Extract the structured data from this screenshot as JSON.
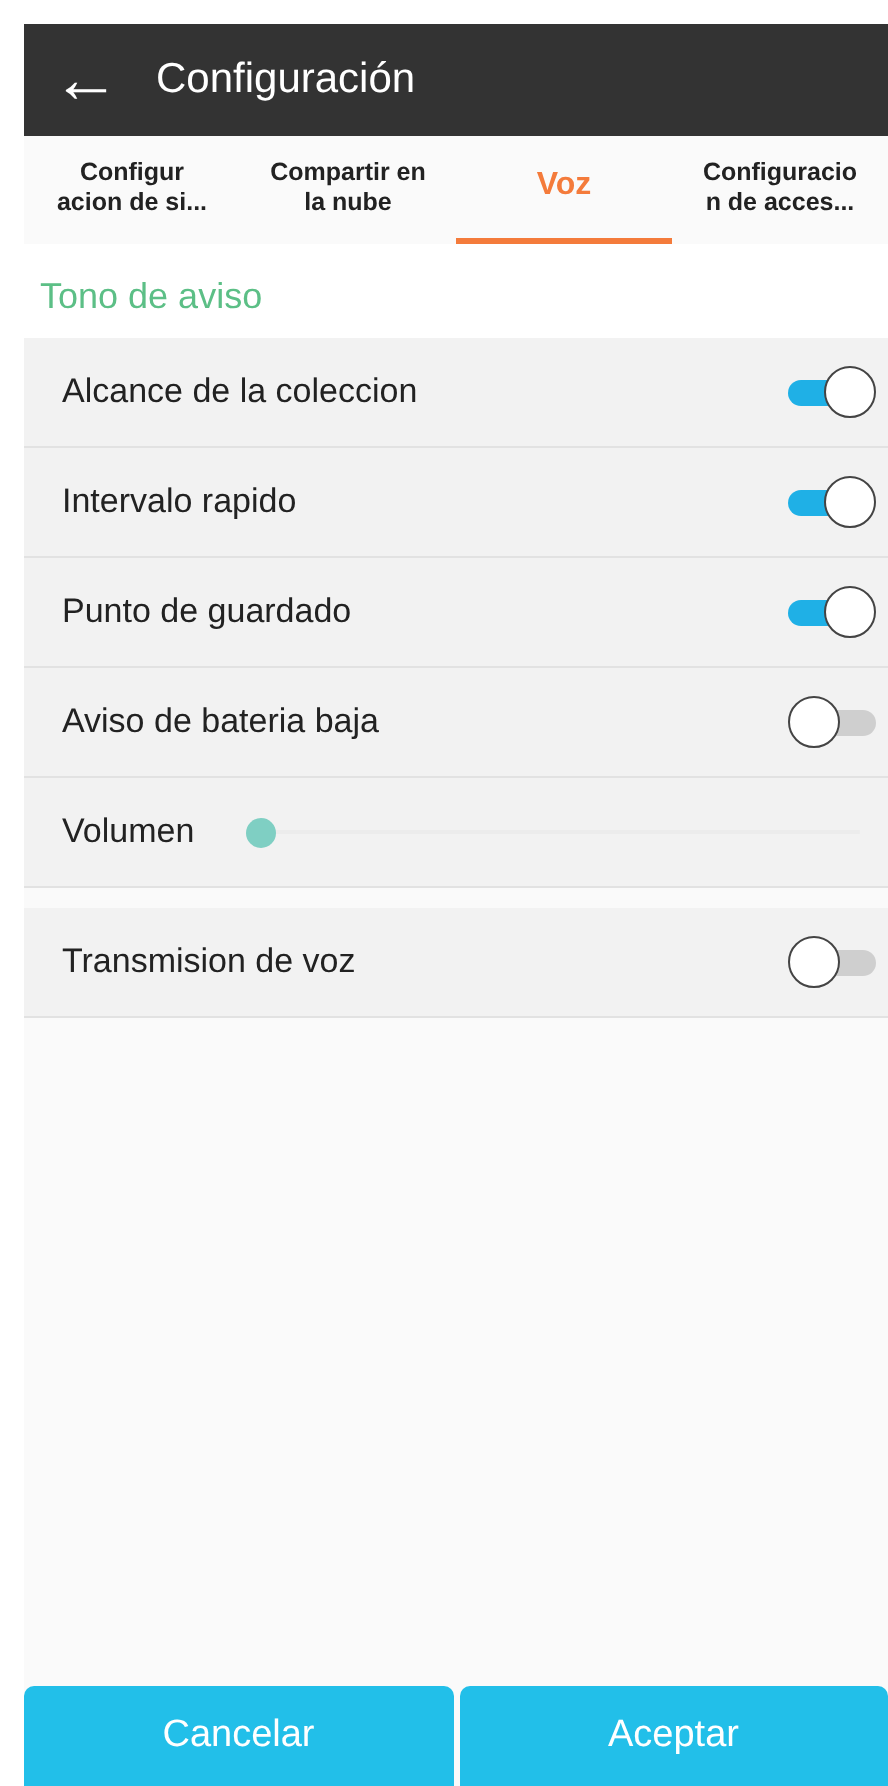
{
  "header": {
    "back": "←",
    "title": "Configuración"
  },
  "tabs": [
    {
      "label": "Configur\nacion de si...",
      "selected": false
    },
    {
      "label": "Compartir en\nla nube",
      "selected": false
    },
    {
      "label": "Voz",
      "selected": true
    },
    {
      "label": "Configuracio\nn de acces...",
      "selected": false
    }
  ],
  "section_title": "Tono de aviso",
  "settings": [
    {
      "kind": "toggle",
      "label": "Alcance de la coleccion",
      "on": true
    },
    {
      "kind": "toggle",
      "label": "Intervalo rapido",
      "on": true
    },
    {
      "kind": "toggle",
      "label": "Punto de guardado",
      "on": true
    },
    {
      "kind": "toggle",
      "label": "Aviso de bateria baja",
      "on": false
    },
    {
      "kind": "slider",
      "label": "Volumen",
      "level": 0
    }
  ],
  "extra_settings": [
    {
      "kind": "toggle",
      "label": "Transmision de voz",
      "on": false
    }
  ],
  "buttons": [
    "Cancelar",
    "Aceptar"
  ]
}
